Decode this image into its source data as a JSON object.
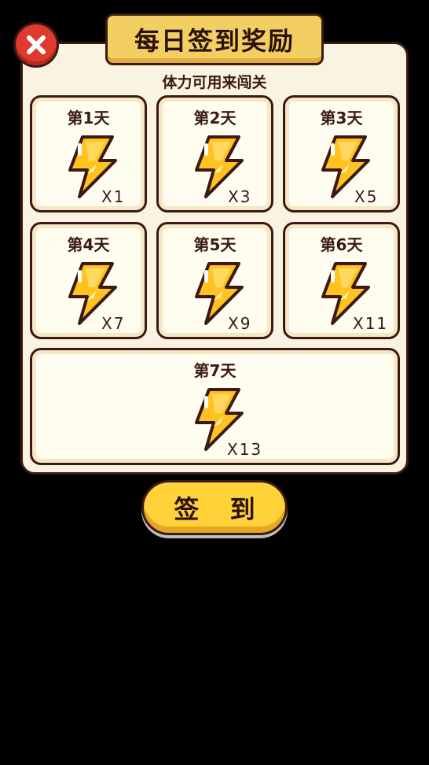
{
  "dialog": {
    "title": "每日签到奖励",
    "subtitle": "体力可用来闯关",
    "sign_button_label": "签 到"
  },
  "rewards": [
    {
      "day": "第1天",
      "qty": "X1"
    },
    {
      "day": "第2天",
      "qty": "X3"
    },
    {
      "day": "第3天",
      "qty": "X5"
    },
    {
      "day": "第4天",
      "qty": "X7"
    },
    {
      "day": "第5天",
      "qty": "X9"
    },
    {
      "day": "第6天",
      "qty": "X11"
    },
    {
      "day": "第7天",
      "qty": "X13"
    }
  ],
  "icons": {
    "close": "close-icon",
    "reward": "lightning-bolt-icon"
  },
  "colors": {
    "banner": "#f3cf63",
    "close": "#e03a2e",
    "button": "#ffd23a",
    "bolt": "#ffc21f",
    "outline": "#3a1a12"
  }
}
